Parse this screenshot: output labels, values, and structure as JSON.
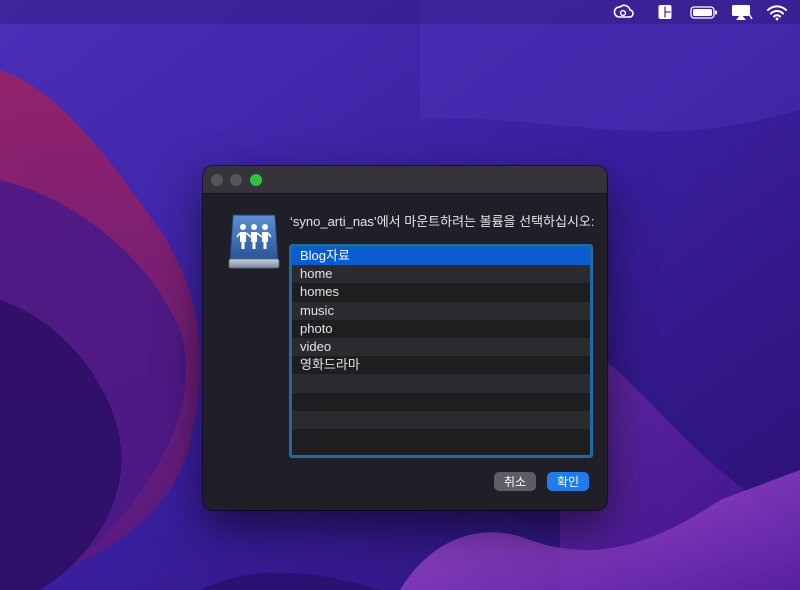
{
  "dialog": {
    "prompt": "‘syno_arti_nas’에서 마운트하려는 볼륨을 선택하십시오:",
    "icon": "shared-network-drive-icon",
    "volumes": [
      "Blog자료",
      "home",
      "homes",
      "music",
      "photo",
      "video",
      "영화드라마",
      "",
      "",
      "",
      ""
    ],
    "selected_index": 0,
    "cancel_label": "취소",
    "ok_label": "확인"
  },
  "menubar": {
    "icons": [
      "creative-cloud-icon",
      "layout-icon",
      "battery-icon",
      "display-mirroring-icon",
      "wifi-icon"
    ]
  },
  "colors": {
    "selection": "#0a5cd0",
    "list_border": "#1c6ba7",
    "ok_button": "#1f7ce8",
    "zoom_button": "#2fc241"
  }
}
